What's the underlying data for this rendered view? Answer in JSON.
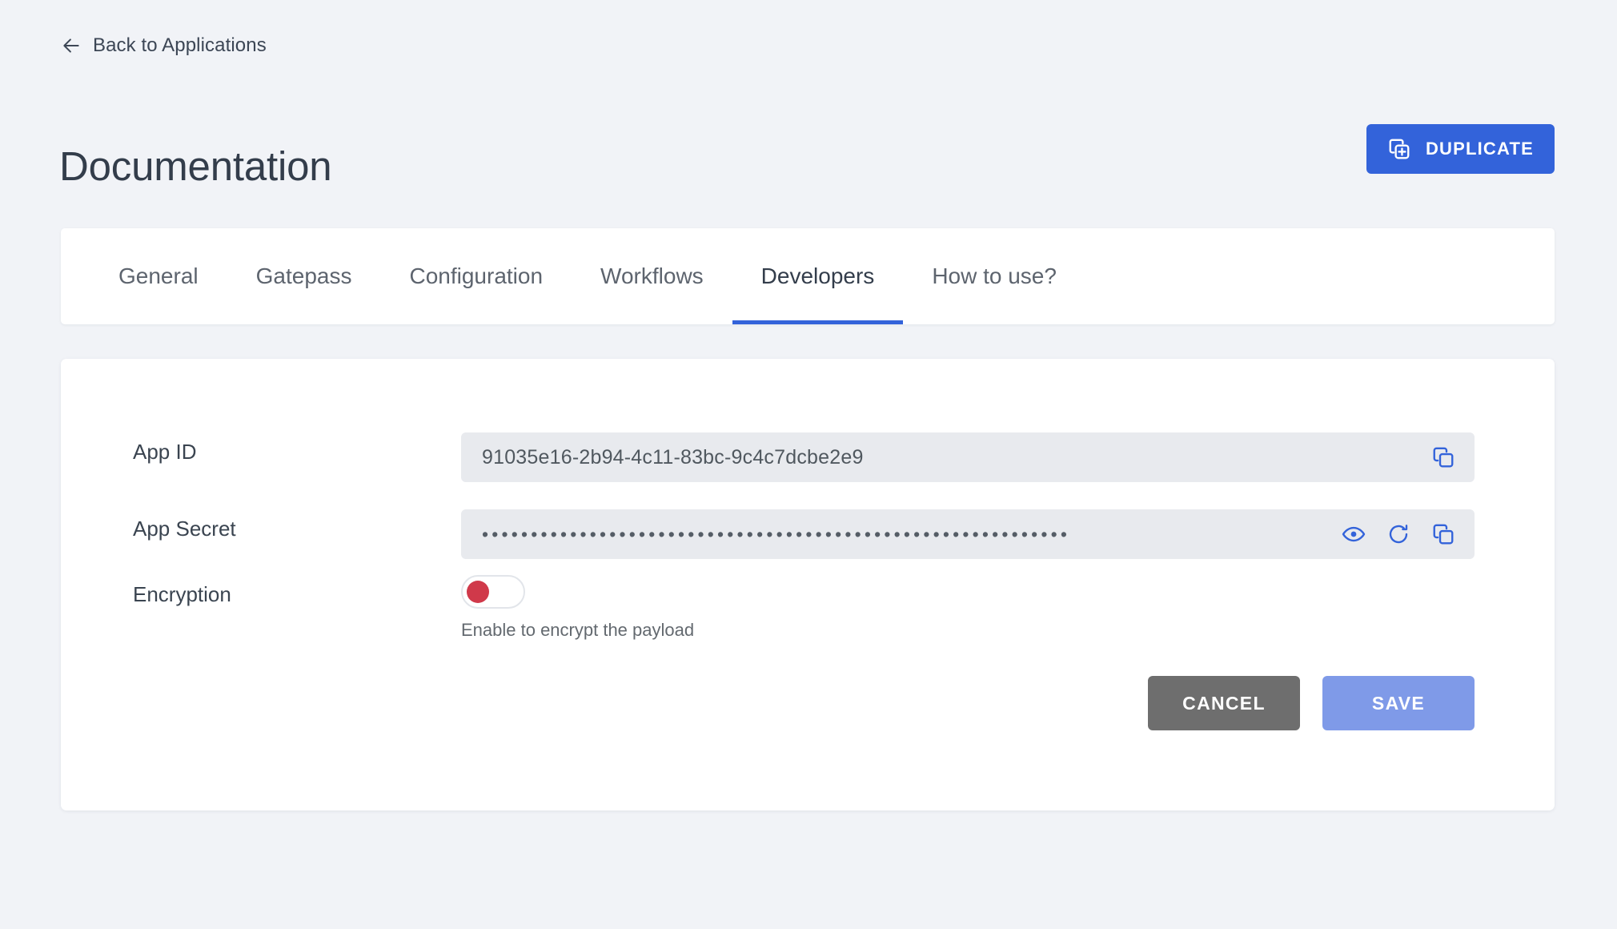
{
  "back_link": {
    "label": "Back to Applications",
    "icon": "arrow-left-icon"
  },
  "header": {
    "title": "Documentation",
    "duplicate_button": {
      "label": "DUPLICATE",
      "icon": "copy-plus-icon",
      "color": "#3363da"
    }
  },
  "tabs": [
    {
      "label": "General",
      "active": false
    },
    {
      "label": "Gatepass",
      "active": false
    },
    {
      "label": "Configuration",
      "active": false
    },
    {
      "label": "Workflows",
      "active": false
    },
    {
      "label": "Developers",
      "active": true
    },
    {
      "label": "How to use?",
      "active": false
    }
  ],
  "tab_accent_color": "#3363da",
  "form": {
    "app_id": {
      "label": "App ID",
      "value": "91035e16-2b94-4c11-83bc-9c4c7dcbe2e9",
      "placeholder": "App ID",
      "actions": [
        {
          "icon": "copy-icon",
          "name": "copy-app-id-button"
        }
      ]
    },
    "app_secret": {
      "label": "App Secret",
      "value": "••••••••••••••••••••••••••••••••••••••••••••••••••••••••••••",
      "masked": true,
      "placeholder": "App Secret",
      "actions": [
        {
          "icon": "eye-icon",
          "name": "reveal-app-secret-button"
        },
        {
          "icon": "refresh-icon",
          "name": "regenerate-app-secret-button"
        },
        {
          "icon": "copy-icon",
          "name": "copy-app-secret-button"
        }
      ]
    },
    "encryption": {
      "label": "Encryption",
      "enabled": false,
      "helper_text": "Enable to encrypt the payload",
      "knob_off_color": "#d0394a"
    }
  },
  "footer": {
    "cancel_label": "CANCEL",
    "save_label": "SAVE",
    "cancel_color": "#6e6e6e",
    "save_color": "#7f9ae8"
  }
}
